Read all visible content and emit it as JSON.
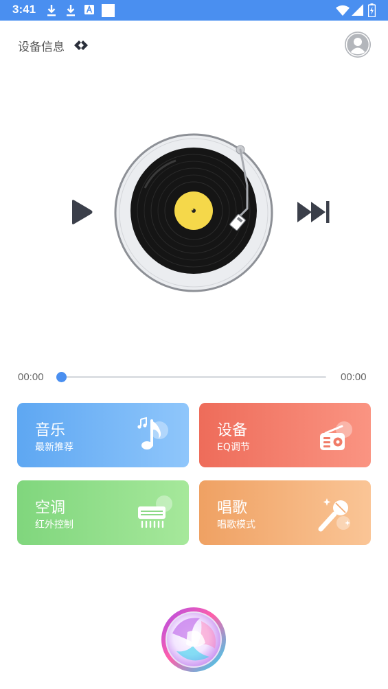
{
  "status_bar": {
    "time": "3:41",
    "left_icons": [
      "download-icon",
      "download-icon",
      "font-a-icon",
      "blank-square-icon"
    ],
    "right_icons": [
      "wifi-icon",
      "signal-icon",
      "battery-charging-icon"
    ],
    "background": "#4a8ff0"
  },
  "header": {
    "device_info_label": "设备信息",
    "link_icon": "link-icon",
    "avatar_icon": "user-avatar-icon"
  },
  "player": {
    "play_icon": "play-icon",
    "next_icon": "skip-next-icon",
    "current_time": "00:00",
    "total_time": "00:00",
    "progress": 0,
    "accent": "#4a8ff0"
  },
  "cards": {
    "music": {
      "title": "音乐",
      "subtitle": "最新推荐",
      "icon": "music-note-icon",
      "colors": [
        "#5ea7f2",
        "#8fc6fb"
      ]
    },
    "device": {
      "title": "设备",
      "subtitle": "EQ调节",
      "icon": "radio-icon",
      "colors": [
        "#ee6c5a",
        "#fa9482"
      ]
    },
    "ac": {
      "title": "空调",
      "subtitle": "红外控制",
      "icon": "air-conditioner-icon",
      "colors": [
        "#80d67d",
        "#a6e89b"
      ]
    },
    "sing": {
      "title": "唱歌",
      "subtitle": "唱歌模式",
      "icon": "microphone-icon",
      "colors": [
        "#efa163",
        "#fac596"
      ]
    }
  },
  "voice_assistant_icon": "voice-orb-icon"
}
